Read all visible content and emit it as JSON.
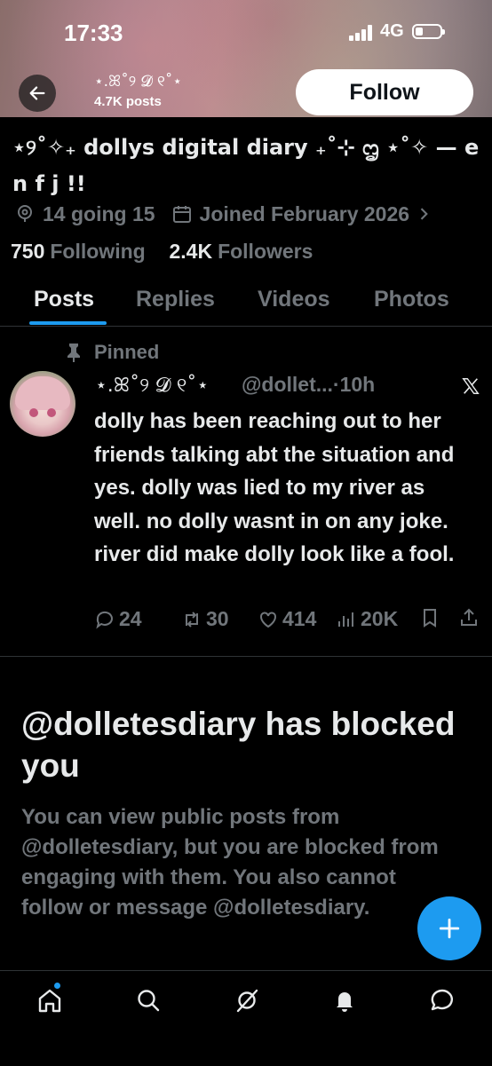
{
  "status_bar": {
    "time": "17:33",
    "network": "4G",
    "battery_level": 0.3
  },
  "header": {
    "display_name": "⋆.ꕤ˚୨ 𝓓 ୧˚⋆",
    "posts_count": "4.7K posts",
    "follow_label": "Follow"
  },
  "profile": {
    "bio": "⋆୨˚✧₊ dollys digital diary ₊˚⊹ ᦗ ⋆˚✧ — e n f j !!",
    "location": "14 going 15",
    "joined": "Joined February 2026",
    "following_count": "750",
    "following_label": "Following",
    "followers_count": "2.4K",
    "followers_label": "Followers"
  },
  "tabs": [
    "Posts",
    "Replies",
    "Videos",
    "Photos"
  ],
  "pinned_tweet": {
    "pinned_label": "Pinned",
    "author_name": "⋆.ꕤ˚୨ 𝓓 ୧˚⋆",
    "meta": "@dollet...·10h",
    "text": "dolly has been reaching out to her friends talking abt the situation and yes. dolly was lied to my river as well. no dolly wasnt in on any joke. river did make dolly look like a fool.",
    "replies": "24",
    "retweets": "30",
    "likes": "414",
    "views": "20K"
  },
  "blocked": {
    "title": "@dolletesdiary has blocked you",
    "body": "You can view public posts from @dolletesdiary, but you are blocked from engaging with them. You also cannot follow or message @dolletesdiary."
  },
  "nav": {
    "items": [
      "home-icon",
      "search-icon",
      "grok-icon",
      "notifications-icon",
      "messages-icon"
    ]
  },
  "colors": {
    "accent": "#1d9bf0",
    "muted": "#71767b",
    "text": "#e7e9ea",
    "background": "#000000"
  }
}
